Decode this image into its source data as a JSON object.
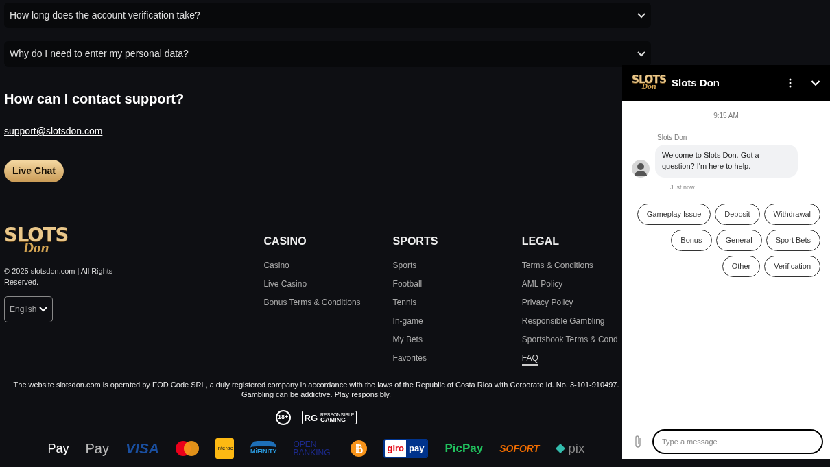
{
  "faq": [
    {
      "question": "How long does the account verification take?",
      "expanded": false
    },
    {
      "question": "Why do I need to enter my personal data?",
      "expanded": false
    }
  ],
  "contact": {
    "heading": "How can I contact support?",
    "email": "support@slotsdon.com",
    "button": "Live Chat"
  },
  "footer": {
    "logo": {
      "line1": "SLOTS",
      "line2": "Don"
    },
    "copyright": "© 2025 slotsdon.com | All Rights Reserved.",
    "language": "English",
    "columns": [
      {
        "title": "CASINO",
        "links": [
          {
            "label": "Casino",
            "selected": false
          },
          {
            "label": "Live Casino",
            "selected": false
          },
          {
            "label": "Bonus Terms & Conditions",
            "selected": false
          }
        ]
      },
      {
        "title": "SPORTS",
        "links": [
          {
            "label": "Sports",
            "selected": false
          },
          {
            "label": "Football",
            "selected": false
          },
          {
            "label": "Tennis",
            "selected": false
          },
          {
            "label": "In-game",
            "selected": false
          },
          {
            "label": "My Bets",
            "selected": false
          },
          {
            "label": "Favorites",
            "selected": false
          }
        ]
      },
      {
        "title": "LEGAL",
        "links": [
          {
            "label": "Terms & Conditions",
            "selected": false
          },
          {
            "label": "AML Policy",
            "selected": false
          },
          {
            "label": "Privacy Policy",
            "selected": false
          },
          {
            "label": "Responsible Gambling",
            "selected": false
          },
          {
            "label": "Sportsbook Terms & Cond",
            "selected": false
          },
          {
            "label": "FAQ",
            "selected": true
          }
        ]
      }
    ],
    "disclaimer": [
      "The website slotsdon.com is operated by EOD Code SRL, a duly registered company in accordance with the laws of the Republic of Costa Rica with Corporate Id. No. 3-101-910497.",
      "Gambling can be addictive. Play responsibly."
    ],
    "badges": [
      {
        "kind": "age",
        "text": "18+"
      },
      {
        "kind": "rg",
        "text": "RG",
        "caption": "RESPONSIBLE",
        "sub": "GAMING"
      }
    ],
    "payments": [
      {
        "kind": "apple",
        "label": "Pay"
      },
      {
        "kind": "gpay",
        "label": "Pay"
      },
      {
        "kind": "visa",
        "label": "VISA"
      },
      {
        "kind": "mastercard"
      },
      {
        "kind": "interac",
        "label": "Interac"
      },
      {
        "kind": "mifinity",
        "label": "MiFINITY"
      },
      {
        "kind": "openbanking",
        "label": "OPEN BANKING"
      },
      {
        "kind": "bitcoin"
      },
      {
        "kind": "giropay",
        "label": "giro",
        "label2": "pay"
      },
      {
        "kind": "picpay",
        "label": "PicPay"
      },
      {
        "kind": "sofort",
        "label": "SOFORT"
      },
      {
        "kind": "pix",
        "label": "pix"
      }
    ]
  },
  "chat": {
    "logo": {
      "line1": "SLOTS",
      "line2": "Don"
    },
    "title": "Slots Don",
    "time": "9:15 AM",
    "sender": "Slots Don",
    "message": "Welcome to Slots Don. Got a question? I'm here to help.",
    "message_time": "Just now",
    "quick_replies": [
      "Gameplay Issue",
      "Deposit",
      "Withdrawal",
      "Bonus",
      "General",
      "Sport Bets",
      "Other",
      "Verification"
    ],
    "input": {
      "placeholder": "Type a message"
    }
  }
}
